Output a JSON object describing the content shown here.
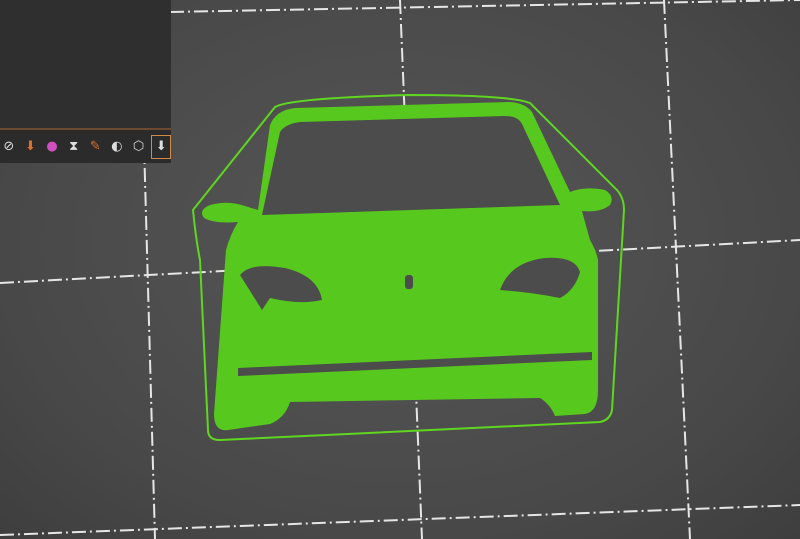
{
  "colors": {
    "bed": "#4a4a4a",
    "grid": "#e8e8e8",
    "model": "#57c81d",
    "skirt": "#5fd620",
    "toolbar": "#2b2b2b",
    "accent": "#d08a4a"
  },
  "toolbar": {
    "icons": [
      "variable-layer-height-icon",
      "place-on-face-icon",
      "color-paint-icon",
      "hourglass-icon",
      "seam-paint-icon",
      "center-of-mass-icon",
      "cube-view-icon",
      "export-arrow-icon"
    ]
  }
}
